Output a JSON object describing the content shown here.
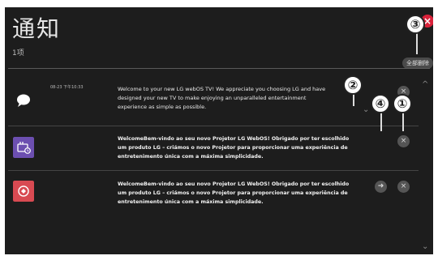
{
  "header": {
    "title": "通知",
    "count": "1项",
    "delete_all_label": "全部删除",
    "close_symbol": "×"
  },
  "notifications": [
    {
      "timestamp": "08-23 下午10:33",
      "message": "Welcome to your new LG webOS TV! We appreciate you choosing LG and have designed your new TV to make enjoying an unparalleled entertainment experience as simple as possible.",
      "icon": "chat-bubble-icon",
      "icon_color": "#ffffff"
    },
    {
      "message": "WelcomeBem-vindo ao seu novo Projetor LG WebOS! Obrigado por ter escolhido um produto LG – criámos o novo Projetor para proporcionar uma experiência de entretenimento única com a máxima simplicidade.",
      "icon": "projector-clock-icon",
      "icon_color": "#6c4fb0"
    },
    {
      "message": "WelcomeBem-vindo ao seu novo Projetor LG WebOS! Obrigado por ter escolhido um produto LG – criámos o novo Projetor para proporcionar uma experiência de entretenimento única com a máxima simplicidade.",
      "icon": "refresh-circle-icon",
      "icon_color": "#d84a52"
    }
  ],
  "callouts": [
    "①",
    "②",
    "③",
    "④"
  ],
  "button_symbols": {
    "dismiss": "×",
    "go": "➜",
    "expand": "⌄",
    "scroll_up": "^",
    "scroll_down": "⌄"
  }
}
